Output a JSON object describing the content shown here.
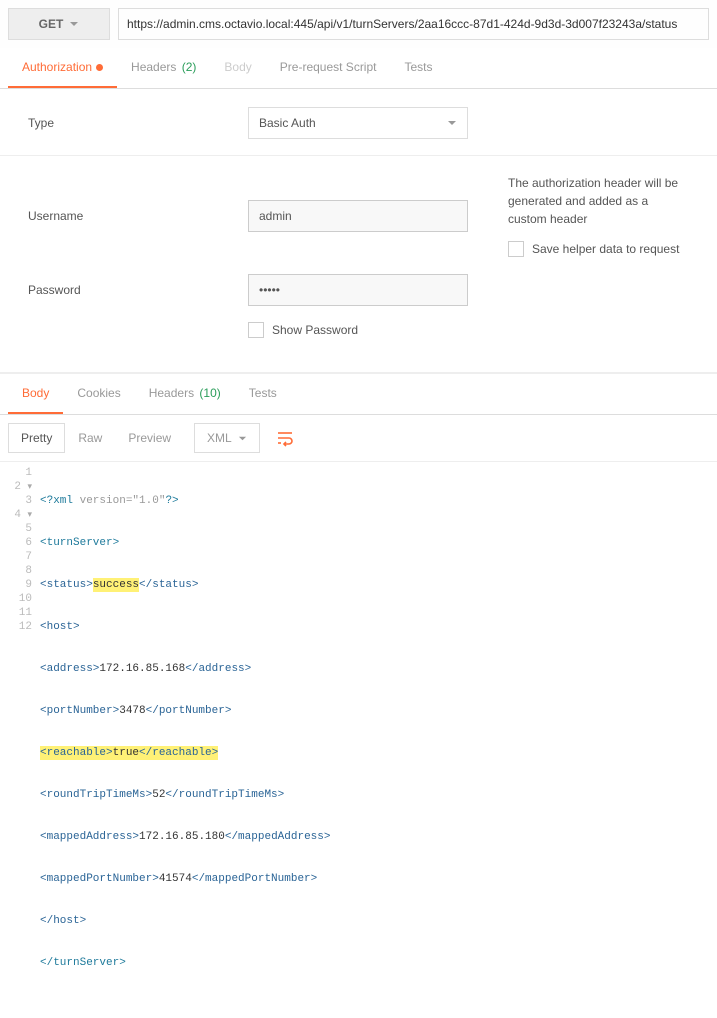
{
  "request": {
    "method": "GET",
    "url_prefix": "https://admin.cms.octavio.local:445/api/v1/turnServers/",
    "url_hl": "2aa16ccc-87d1-424d-9d3d-3d007f23243a/status"
  },
  "req_tabs": {
    "auth": "Authorization",
    "headers": "Headers",
    "headers_count": "(2)",
    "body": "Body",
    "prs": "Pre-request Script",
    "tests": "Tests"
  },
  "auth": {
    "type_label": "Type",
    "type_value": "Basic Auth",
    "user_label": "Username",
    "user_value": "admin",
    "pass_label": "Password",
    "pass_value": "•••••",
    "showpw": "Show Password",
    "note": "The authorization header will be generated and added as a custom header",
    "save_helper": "Save helper data to request"
  },
  "res_tabs": {
    "body": "Body",
    "cookies": "Cookies",
    "headers": "Headers",
    "headers_count": "(10)",
    "tests": "Tests"
  },
  "res_toolbar": {
    "pretty": "Pretty",
    "raw": "Raw",
    "preview": "Preview",
    "format": "XML"
  },
  "chart_data": {
    "type": "table",
    "format": "xml",
    "root": "turnServer",
    "status": "success",
    "host": {
      "address": "172.16.85.168",
      "portNumber": 3478,
      "reachable": true,
      "roundTripTimeMs": 52,
      "mappedAddress": "172.16.85.180",
      "mappedPortNumber": 41574
    }
  },
  "code_labels": {
    "xml_decl_pre": "<?xml ",
    "xml_decl_attr": "version=\"1.0\"",
    "xml_decl_post": "?>",
    "status_val": "success",
    "addr_val": "172.16.85.168",
    "port_val": "3478",
    "reach_val": "true",
    "rtt_val": "52",
    "maddr_val": "172.16.85.180",
    "mport_val": "41574"
  },
  "line_numbers": [
    "1",
    "2",
    "3",
    "4",
    "5",
    "6",
    "7",
    "8",
    "9",
    "10",
    "11",
    "12"
  ]
}
